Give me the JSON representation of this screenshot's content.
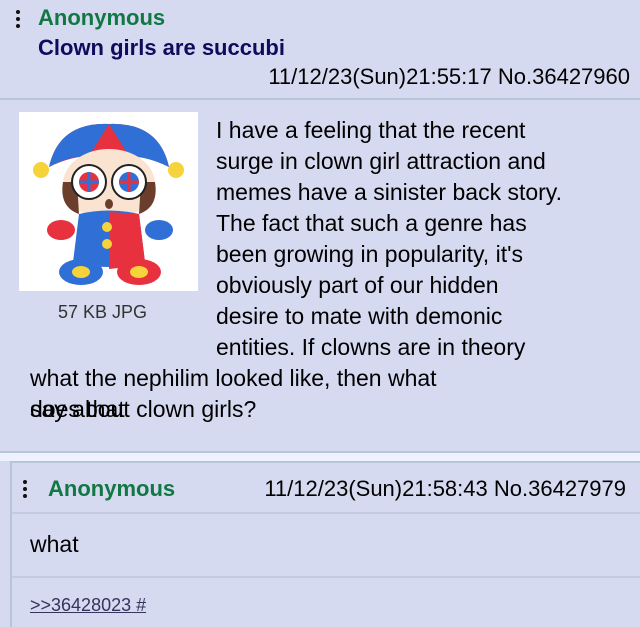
{
  "op": {
    "name": "Anonymous",
    "subject": "Clown girls are succubi",
    "datetime": "11/12/23(Sun)21:55:17",
    "post_number": "No.36427960",
    "file_info": "57 KB JPG",
    "body_lines": [
      "I have a feeling that the recent",
      "surge in clown girl attraction and",
      "memes have a sinister back story.",
      "The fact that such a genre has",
      "been growing in popularity, it's",
      "obviously part of our hidden",
      "desire to mate with demonic",
      "entities. If clowns are in theory"
    ],
    "body_wide_lines": [
      "what the nephilim looked like, then what does that",
      "say about clown girls?"
    ]
  },
  "reply": {
    "name": "Anonymous",
    "datetime": "11/12/23(Sun)21:58:43",
    "post_number": "No.36427979",
    "body": "what",
    "backlink": ">>36428023 #"
  },
  "colors": {
    "background": "#d6daf0",
    "name_green": "#117743",
    "subject_navy": "#0f0c5d",
    "border": "#b7c5d9"
  }
}
